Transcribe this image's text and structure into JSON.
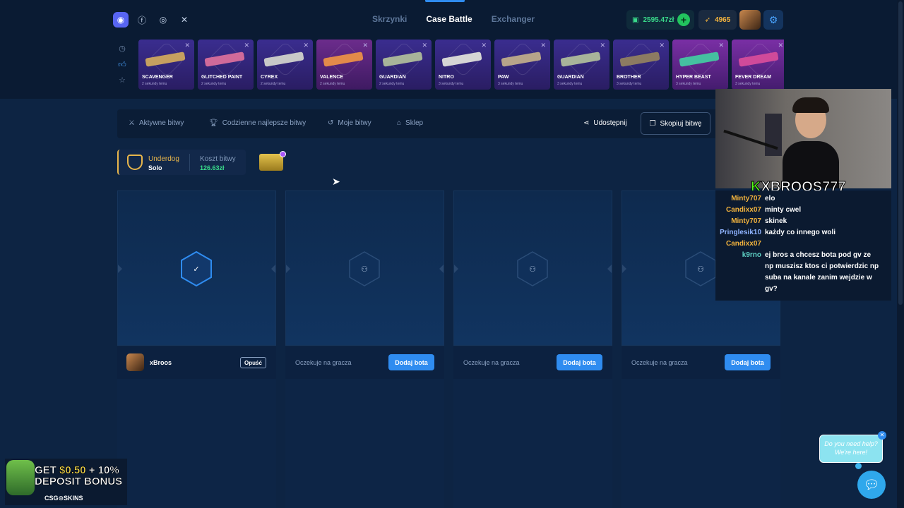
{
  "nav": {
    "tabs": [
      "Skrzynki",
      "Case Battle",
      "Exchanger"
    ],
    "active": "Case Battle"
  },
  "social": [
    "discord-icon",
    "facebook-icon",
    "instagram-icon",
    "x-icon"
  ],
  "wallet": {
    "balance": "2595.47zł",
    "points": "4965"
  },
  "live_drops": [
    {
      "name": "SCAVENGER",
      "time": "2 sekundy temu",
      "tone": "blue"
    },
    {
      "name": "GLITCHED PAINT",
      "time": "2 sekundy temu",
      "tone": "blue"
    },
    {
      "name": "CYREX",
      "time": "2 sekundy temu",
      "tone": "blue"
    },
    {
      "name": "VALENCE",
      "time": "2 sekundy temu",
      "tone": "red"
    },
    {
      "name": "GUARDIAN",
      "time": "2 sekundy temu",
      "tone": "blue"
    },
    {
      "name": "NITRO",
      "time": "3 sekundy temu",
      "tone": "blue"
    },
    {
      "name": "PAW",
      "time": "3 sekundy temu",
      "tone": "blue"
    },
    {
      "name": "GUARDIAN",
      "time": "3 sekundy temu",
      "tone": "blue"
    },
    {
      "name": "BROTHER",
      "time": "3 sekundy temu",
      "tone": "blue"
    },
    {
      "name": "HYPER BEAST",
      "time": "3 sekundy temu",
      "tone": "pink"
    },
    {
      "name": "FEVER DREAM",
      "time": "3 sekundy temu",
      "tone": "pink"
    }
  ],
  "battle_tabs": {
    "active": "Aktywne bitwy",
    "daily": "Codzienne najlepsze bitwy",
    "mine": "Moje bitwy",
    "shop": "Sklep",
    "share": "Udostępnij",
    "copy": "Skopiuj bitwę"
  },
  "battle": {
    "mode_label": "Underdog",
    "mode_value": "Solo",
    "cost_label": "Koszt bitwy",
    "cost_value": "126.63zł"
  },
  "slots": [
    {
      "player": "xBroos",
      "leave": "Opuść",
      "ready": true
    },
    {
      "wait": "Oczekuje na gracza",
      "bot": "Dodaj bota"
    },
    {
      "wait": "Oczekuje na gracza",
      "bot": "Dodaj bota"
    },
    {
      "wait": "Oczekuje na gracza",
      "bot": "Dodaj bota"
    }
  ],
  "stream": {
    "streamer": "XBROOS777",
    "chat": [
      {
        "user": "Minty707",
        "text": "elo",
        "color": "#f3b33d"
      },
      {
        "user": "Candixx07",
        "text": "minty cwel",
        "color": "#f3b33d"
      },
      {
        "user": "Minty707",
        "text": "skinek",
        "color": "#f3b33d"
      },
      {
        "user": "Pringlesik10",
        "text": "każdy co innego woli",
        "color": "#8fb3ff"
      },
      {
        "user": "Candixx07",
        "text": "",
        "color": "#f3b33d"
      },
      {
        "user": "k9rno",
        "text": "ej bros a chcesz bota pod gv ze np muszisz ktos ci potwierdzic np suba na kanale zanim wejdzie w gv?",
        "color": "#5ed0c4"
      }
    ]
  },
  "help": {
    "text": "Do you need help? We're here!"
  },
  "promo": {
    "line1a": "GET ",
    "line1b": "$0.50",
    "line1c": " + 10%",
    "line2": "DEPOSIT BONUS",
    "brand": "CSG⊙SKINS"
  },
  "colors": {
    "accent": "#2f8cf0",
    "money": "#39d98a",
    "gold": "#e8b64b",
    "bg": "#0d2443"
  }
}
